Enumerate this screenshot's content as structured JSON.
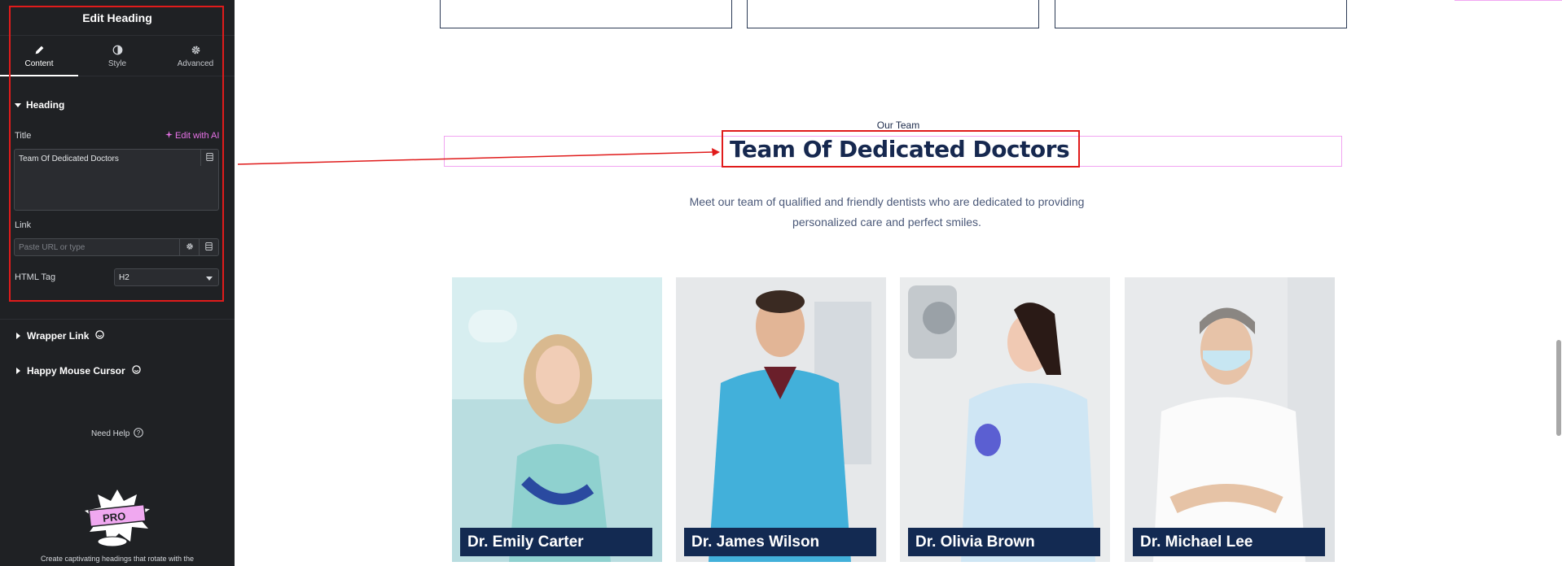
{
  "sidebar": {
    "header_title": "Edit Heading",
    "tabs": [
      {
        "label": "Content",
        "icon": "pencil-icon",
        "active": true
      },
      {
        "label": "Style",
        "icon": "half-circle-icon",
        "active": false
      },
      {
        "label": "Advanced",
        "icon": "gear-icon",
        "active": false
      }
    ],
    "section_heading": "Heading",
    "title_label": "Title",
    "ai_link": "Edit with AI",
    "title_value": "Team Of Dedicated Doctors",
    "link_label": "Link",
    "link_placeholder": "Paste URL or type",
    "html_tag_label": "HTML Tag",
    "html_tag_value": "H2",
    "wrapper_link": "Wrapper Link",
    "happy_mouse_cursor": "Happy Mouse Cursor",
    "need_help": "Need Help",
    "promo_badge": "PRO",
    "promo_text": "Create captivating headings that rotate with the"
  },
  "canvas": {
    "eyebrow": "Our Team",
    "heading": "Team Of Dedicated Doctors",
    "lead_line1": "Meet our team of qualified and friendly dentists who are dedicated to providing",
    "lead_line2": "personalized care and perfect smiles.",
    "doctors": [
      {
        "name": "Dr. Emily Carter"
      },
      {
        "name": "Dr. James Wilson"
      },
      {
        "name": "Dr. Olivia Brown"
      },
      {
        "name": "Dr. Michael Lee"
      }
    ]
  },
  "colors": {
    "sidebar_bg": "#1f2124",
    "accent_pink": "#e873e8",
    "highlight_red": "#e01b1b",
    "heading_navy": "#16284f",
    "label_navy": "#132a52"
  }
}
